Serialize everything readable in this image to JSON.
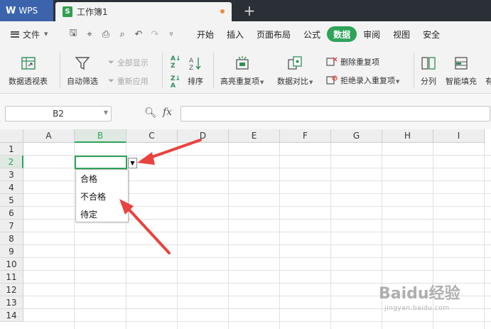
{
  "titlebar": {
    "app_name": "WPS",
    "doc_tab": "工作簿1",
    "new_tab_symbol": "+"
  },
  "menubar": {
    "file_label": "文件",
    "tabs": [
      {
        "label": "开始"
      },
      {
        "label": "插入"
      },
      {
        "label": "页面布局"
      },
      {
        "label": "公式"
      },
      {
        "label": "数据"
      },
      {
        "label": "审阅"
      },
      {
        "label": "视图"
      },
      {
        "label": "安全"
      }
    ],
    "active_tab": "数据"
  },
  "ribbon": {
    "pivot": "数据透视表",
    "autofilter": "自动筛选",
    "show_all": "全部显示",
    "reapply": "重新应用",
    "sort": "排序",
    "highlight_dup": "高亮重复项",
    "compare": "数据对比",
    "remove_dup": "删除重复项",
    "reject_dup": "拒绝录入重复项",
    "split": "分列",
    "fill": "智能填充",
    "cut_off": "有"
  },
  "formula_bar": {
    "name_box": "B2",
    "fx_label": "fx",
    "formula": ""
  },
  "sheet": {
    "columns": [
      "A",
      "B",
      "C",
      "D",
      "E",
      "F",
      "G",
      "H",
      "I"
    ],
    "rows": [
      "1",
      "2",
      "3",
      "4",
      "5",
      "6",
      "7",
      "8",
      "9",
      "10",
      "11",
      "12",
      "13",
      "14"
    ],
    "active_column": "B",
    "active_row": "2",
    "dropdown_options": [
      "合格",
      "不合格",
      "待定"
    ]
  },
  "colors": {
    "accent_green": "#2ea35a",
    "wps_blue": "#3c64ad",
    "annotation_red": "#e8433f"
  },
  "watermark": {
    "text": "Baidu经验",
    "sub": "jingyan.baidu.com"
  }
}
